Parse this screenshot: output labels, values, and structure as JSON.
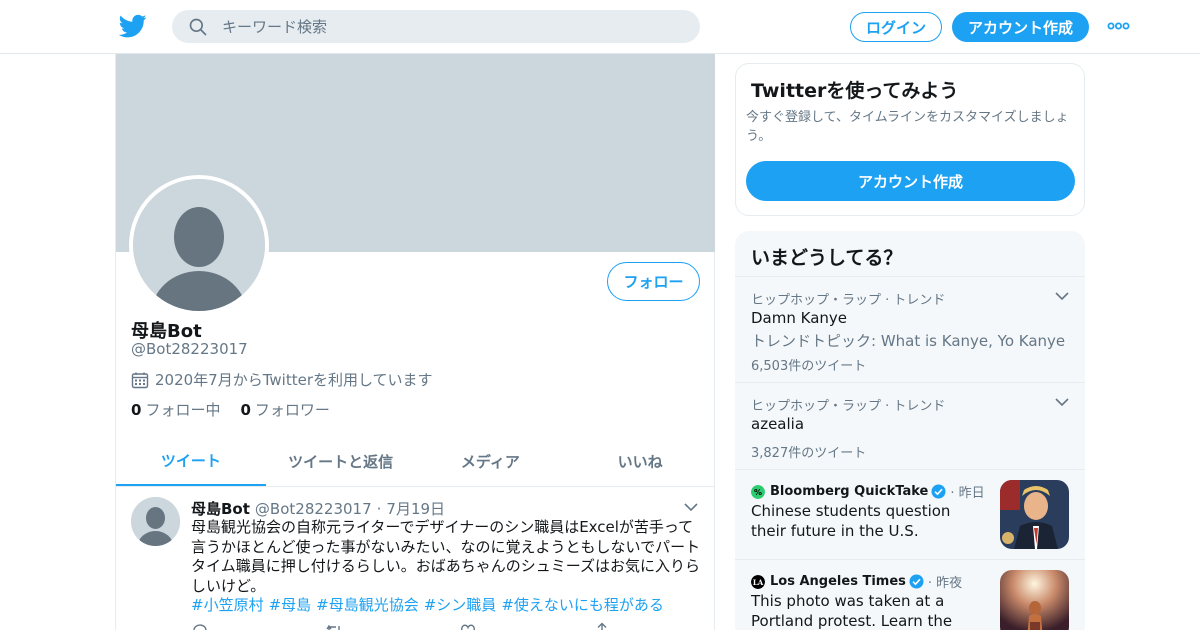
{
  "header": {
    "search_placeholder": "キーワード検索",
    "login_label": "ログイン",
    "signup_label": "アカウント作成"
  },
  "profile": {
    "display_name": "母島Bot",
    "handle": "@Bot28223017",
    "joined": "2020年7月からTwitterを利用しています",
    "following_count": "0",
    "following_label": "フォロー中",
    "followers_count": "0",
    "followers_label": "フォロワー",
    "follow_label": "フォロー"
  },
  "tabs": [
    {
      "label": "ツイート"
    },
    {
      "label": "ツイートと返信"
    },
    {
      "label": "メディア"
    },
    {
      "label": "いいね"
    }
  ],
  "tweet": {
    "name": "母島Bot",
    "handle": "@Bot28223017",
    "sep": "·",
    "date": "7月19日",
    "text": "母島観光協会の自称元ライターでデザイナーのシン職員はExcelが苦手って言うかほとんど使った事がないみたい、なのに覚えようともしないでパートタイム職員に押し付けるらしい。おばあちゃんのシュミーズはお気に入りらしいけど。",
    "hashtags": [
      "#小笠原村",
      "#母島",
      "#母島観光協会",
      "#シン職員",
      "#使えないにも程がある"
    ]
  },
  "sidebar": {
    "try_title": "Twitterを使ってみよう",
    "try_text": "今すぐ登録して、タイムラインをカスタマイズしましょう。",
    "try_button": "アカウント作成",
    "trends_title": "いまどうしてる？",
    "trends": [
      {
        "meta": "ヒップホップ・ラップ · トレンド",
        "title": "Damn Kanye",
        "desc": "トレンドトピック: What is Kanye, Yo Kanye",
        "count": "6,503件のツイート"
      },
      {
        "meta": "ヒップホップ・ラップ · トレンド",
        "title": "azealia",
        "count": "3,827件のツイート"
      }
    ],
    "news": [
      {
        "source": "Bloomberg QuickTake",
        "ago": "· 昨日",
        "headline": "Chinese students question their future in the U.S."
      },
      {
        "source": "Los Angeles Times",
        "ago": "· 昨夜",
        "headline": "This photo was taken at a Portland protest. Learn the story behind it:"
      }
    ]
  },
  "colors": {
    "accent": "#1da1f2",
    "banner": "#ccd6dd",
    "muted": "#657786",
    "avatar_silhouette": "#66757f"
  },
  "icons": [
    "twitter-bird-icon",
    "search-icon",
    "more-dots-icon",
    "calendar-icon",
    "chevron-down-icon",
    "verified-badge-icon",
    "reply-icon",
    "retweet-icon",
    "like-icon",
    "share-icon"
  ]
}
